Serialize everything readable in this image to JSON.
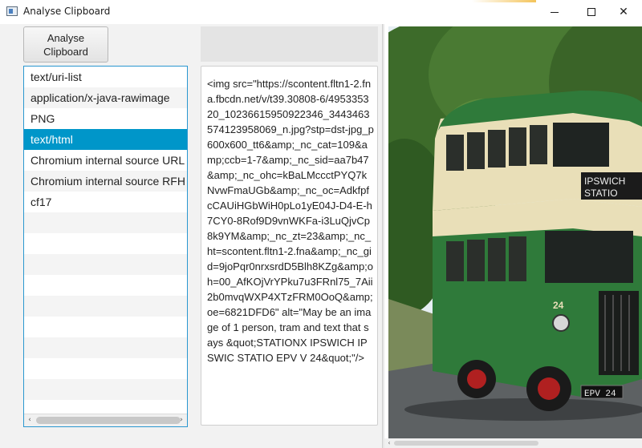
{
  "window": {
    "title": "Analyse Clipboard",
    "minimize_icon": "minimize-icon",
    "maximize_icon": "maximize-icon",
    "close_icon": "close-icon",
    "close_glyph": "✕"
  },
  "toolbar": {
    "analyse_label_line1": "Analyse",
    "analyse_label_line2": "Clipboard"
  },
  "flavor_list": {
    "items": [
      "text/uri-list",
      "application/x-java-rawimage",
      "PNG",
      "text/html",
      "Chromium internal source URL",
      "Chromium internal source RFH token",
      "cf17"
    ],
    "selected_index": 3
  },
  "content": {
    "text": "<img src=\"https://scontent.fltn1-2.fna.fbcdn.net/v/t39.30808-6/495335320_10236615950922346_3443463574123958069_n.jpg?stp=dst-jpg_p600x600_tt6&amp;_nc_cat=109&amp;ccb=1-7&amp;_nc_sid=aa7b47&amp;_nc_ohc=kBaLMccctPYQ7kNvwFmaUGb&amp;_nc_oc=AdkfpfcCAUiHGbWiH0pLo1yE04J-D4-E-h7CY0-8Rof9D9vnWKFa-i3LuQjvCp8k9YM&amp;_nc_zt=23&amp;_nc_ht=scontent.fltn1-2.fna&amp;_nc_gid=9joPqr0nrxsrdD5Blh8KZg&amp;oh=00_AfKOjVrYPku7u3FRnl75_7Aii2b0mvqWXP4XTzFRM0OoQ&amp;oe=6821DFD6\" alt=\"May be an image of 1 person, tram and text that says &quot;STATIONX IPSWICH IPSWIC STATIO EPV V 24&quot;\"/>"
  },
  "image_preview": {
    "bus_dest_line1": "IPSWICH",
    "bus_dest_line2": "STATIO",
    "bus_fleet_no": "24",
    "bus_reg": "EPV 24",
    "colors": {
      "bus_green": "#2f7a3a",
      "bus_cream": "#e9dfb8",
      "sky": "#dde8f0",
      "road": "#5d6163"
    }
  },
  "scroll": {
    "left_arrow": "‹",
    "right_arrow": "›"
  }
}
